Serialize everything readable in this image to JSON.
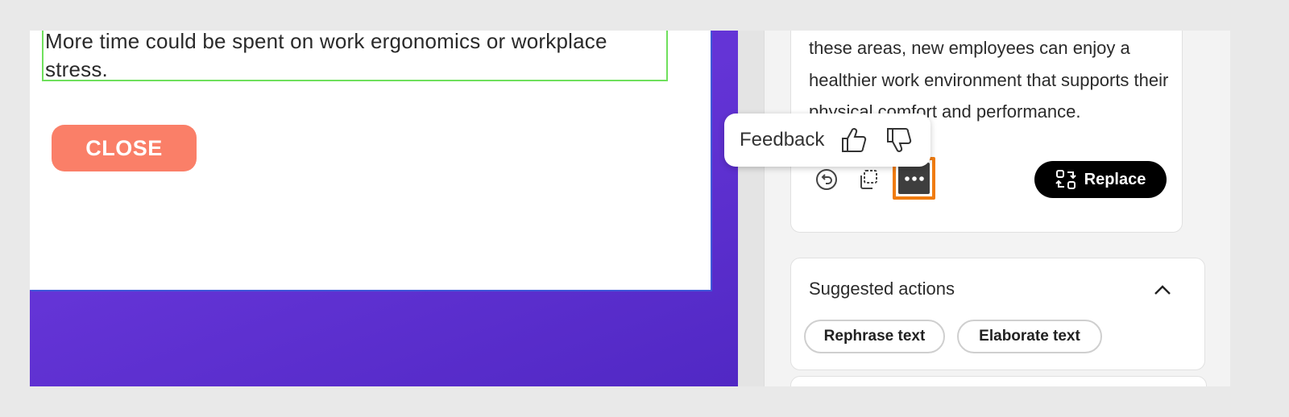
{
  "canvas": {
    "text_box": "More time could be spent on work ergonomics or workplace stress.",
    "close_label": "CLOSE"
  },
  "panel": {
    "result_text": "these areas, new employees can enjoy a healthier work environment that supports their physical comfort and performance.",
    "actions": {
      "undo_icon": "undo-icon",
      "copy_icon": "copy-icon",
      "more_icon": "more-options-icon",
      "replace_label": "Replace"
    },
    "suggested": {
      "title": "Suggested actions",
      "chips": [
        "Rephrase text",
        "Elaborate text"
      ]
    }
  },
  "feedback": {
    "label": "Feedback",
    "thumbs_up_icon": "thumbs-up-icon",
    "thumbs_down_icon": "thumbs-down-icon"
  },
  "colors": {
    "canvas_purple": "#5a31d4",
    "close_button": "#fa7f68",
    "selection_green": "#6fe05c",
    "focus_orange": "#f07c10",
    "replace_button": "#000000"
  }
}
